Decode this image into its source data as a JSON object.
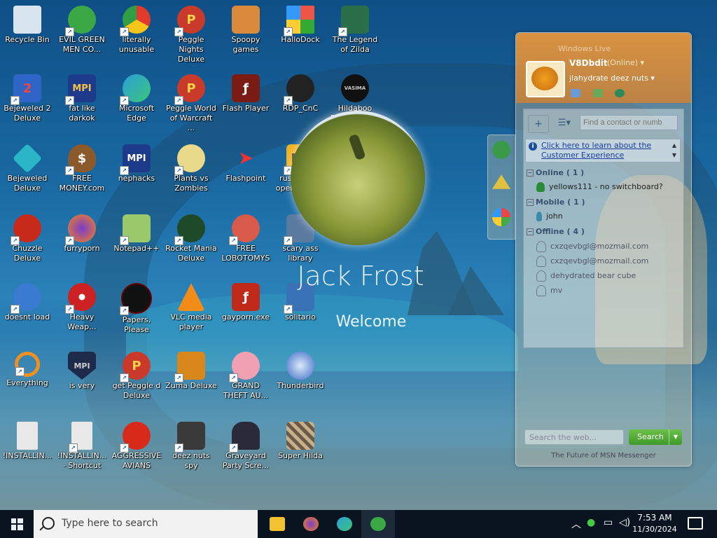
{
  "desktop": {
    "icons": [
      {
        "label": "Recycle Bin"
      },
      {
        "label": "EVIL GREEN MEN CO..."
      },
      {
        "label": "literally unusable"
      },
      {
        "label": "Peggle Nights Deluxe"
      },
      {
        "label": "Spoopy games"
      },
      {
        "label": "HalloDock"
      },
      {
        "label": "The Legend of Zilda"
      },
      {
        "label": "Bejeweled 2 Deluxe"
      },
      {
        "label": "fat like darkok"
      },
      {
        "label": "Microsoft Edge"
      },
      {
        "label": "Peggle World of Warcraft ..."
      },
      {
        "label": "Flash Player"
      },
      {
        "label": "RDP_CnC"
      },
      {
        "label": "Hildaboo Ransomwa..."
      },
      {
        "label": "Bejeweled Deluxe"
      },
      {
        "label": "FREE MONEY.com"
      },
      {
        "label": "nephacks"
      },
      {
        "label": "Plants vs Zombies"
      },
      {
        "label": "Flashpoint"
      },
      {
        "label": "russian kid opened a rat"
      },
      {
        "label": "Chuzzle Deluxe"
      },
      {
        "label": "furryporn"
      },
      {
        "label": "Notepad++"
      },
      {
        "label": "Rocket Mania Deluxe"
      },
      {
        "label": "FREE LOBOTOMYS"
      },
      {
        "label": "scary ass library"
      },
      {
        "label": "doesnt load"
      },
      {
        "label": "Heavy Weap..."
      },
      {
        "label": "Papers, Please"
      },
      {
        "label": "VLC media player"
      },
      {
        "label": "gayporn.exe"
      },
      {
        "label": "solitario"
      },
      {
        "label": "Everything"
      },
      {
        "label": "is very"
      },
      {
        "label": "get Peggle d Deluxe"
      },
      {
        "label": "Zuma Deluxe"
      },
      {
        "label": "GRAND THEFT AU..."
      },
      {
        "label": "Thunderbird"
      },
      {
        "label": "!INSTALLIN..."
      },
      {
        "label": "!INSTALLIN... - Shortcut"
      },
      {
        "label": "AGGRESSIVE AVIANS"
      },
      {
        "label": "deez nuts spy"
      },
      {
        "label": "Graveyard Party Scre..."
      },
      {
        "label": "Super Hilda"
      }
    ]
  },
  "login": {
    "name": "Jack Frost",
    "welcome": "Welcome"
  },
  "msn": {
    "title": "Windows Live",
    "username": "V8Dbdit",
    "status": "(Online) ▾",
    "psm": "jlahydrate deez nuts ▾",
    "contact_search_placeholder": "Find a contact or numb",
    "info_link": "Click here to learn about the Customer Experience",
    "groups": [
      {
        "name": "Online ( 1 )",
        "contacts": [
          {
            "name": "yellows111 - no switchboard?"
          }
        ]
      },
      {
        "name": "Mobile ( 1 )",
        "contacts": [
          {
            "name": "john"
          }
        ]
      },
      {
        "name": "Offline ( 4 )",
        "contacts": [
          {
            "name": "cxzqevbgl@mozmail.com"
          },
          {
            "name": "cxzqevbgl@mozmail.com"
          },
          {
            "name": "dehydrated bear cube"
          },
          {
            "name": "mv"
          }
        ]
      }
    ],
    "web_search_placeholder": "Search the web...",
    "search_button": "Search",
    "footer": "The Future of MSN Messenger"
  },
  "taskbar": {
    "search_placeholder": "Type here to search",
    "time": "7:53 AM",
    "date": "11/30/2024"
  }
}
